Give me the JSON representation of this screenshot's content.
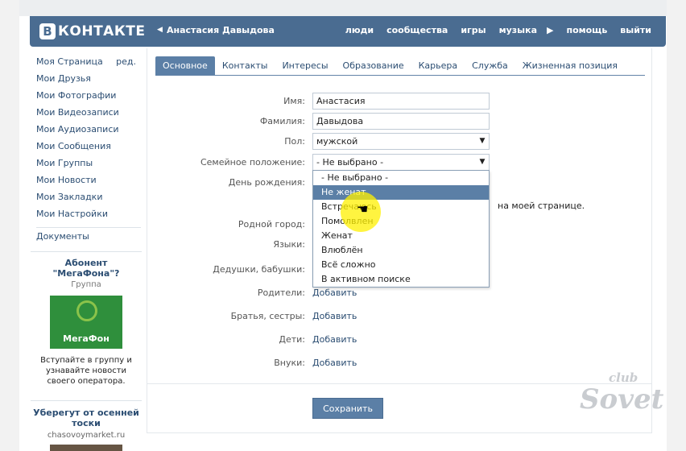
{
  "header": {
    "logo_letter": "В",
    "logo_text": "КОНТАКТЕ",
    "back_icon": "◀",
    "user_name": "Анастасия Давыдова",
    "nav": [
      "люди",
      "сообщества",
      "игры",
      "музыка"
    ],
    "play_icon": "▶",
    "help": "помощь",
    "logout": "выйти",
    "bg_color": "#4a6c91"
  },
  "sidebar": {
    "items": [
      {
        "label": "Моя Страница",
        "edit": "ред."
      },
      {
        "label": "Мои Друзья"
      },
      {
        "label": "Мои Фотографии"
      },
      {
        "label": "Мои Видеозаписи"
      },
      {
        "label": "Мои Аудиозаписи"
      },
      {
        "label": "Мои Сообщения"
      },
      {
        "label": "Мои Группы"
      },
      {
        "label": "Мои Новости"
      },
      {
        "label": "Мои Закладки"
      },
      {
        "label": "Мои Настройки"
      }
    ],
    "docs": "Документы"
  },
  "ad": {
    "title": "Абонент \"МегаФона\"?",
    "subtitle": "Группа",
    "brand": "МегаФон",
    "text": "Вступайте в группу и узнавайте новости своего оператора."
  },
  "ad2": {
    "title": "Уберегут от осенней тоски",
    "link": "chasovoymarket.ru"
  },
  "tabs": [
    "Основное",
    "Контакты",
    "Интересы",
    "Образование",
    "Карьера",
    "Служба",
    "Жизненная позиция"
  ],
  "form": {
    "first_name_label": "Имя:",
    "first_name": "Анастасия",
    "last_name_label": "Фамилия:",
    "last_name": "Давыдова",
    "gender_label": "Пол:",
    "gender": "мужской",
    "marital_label": "Семейное положение:",
    "marital": "- Не выбрано -",
    "birthday_label": "День рождения:",
    "show_on_page": "на моей странице.",
    "hometown_label": "Родной город:",
    "languages_label": "Языки:",
    "grandparents_label": "Дедушки, бабушки:",
    "parents_label": "Родители:",
    "siblings_label": "Братья, сестры:",
    "children_label": "Дети:",
    "grandchildren_label": "Внуки:",
    "add_link": "Добавить",
    "save_button": "Сохранить",
    "select_arrow": "▼"
  },
  "dropdown": {
    "options": [
      "- Не выбрано -",
      "Не женат",
      "Встречаюсь",
      "Помолвлен",
      "Женат",
      "Влюблён",
      "Всё сложно",
      "В активном поиске"
    ],
    "highlighted_index": 1
  },
  "watermark": {
    "line1": "club",
    "line2": "Sovet"
  }
}
